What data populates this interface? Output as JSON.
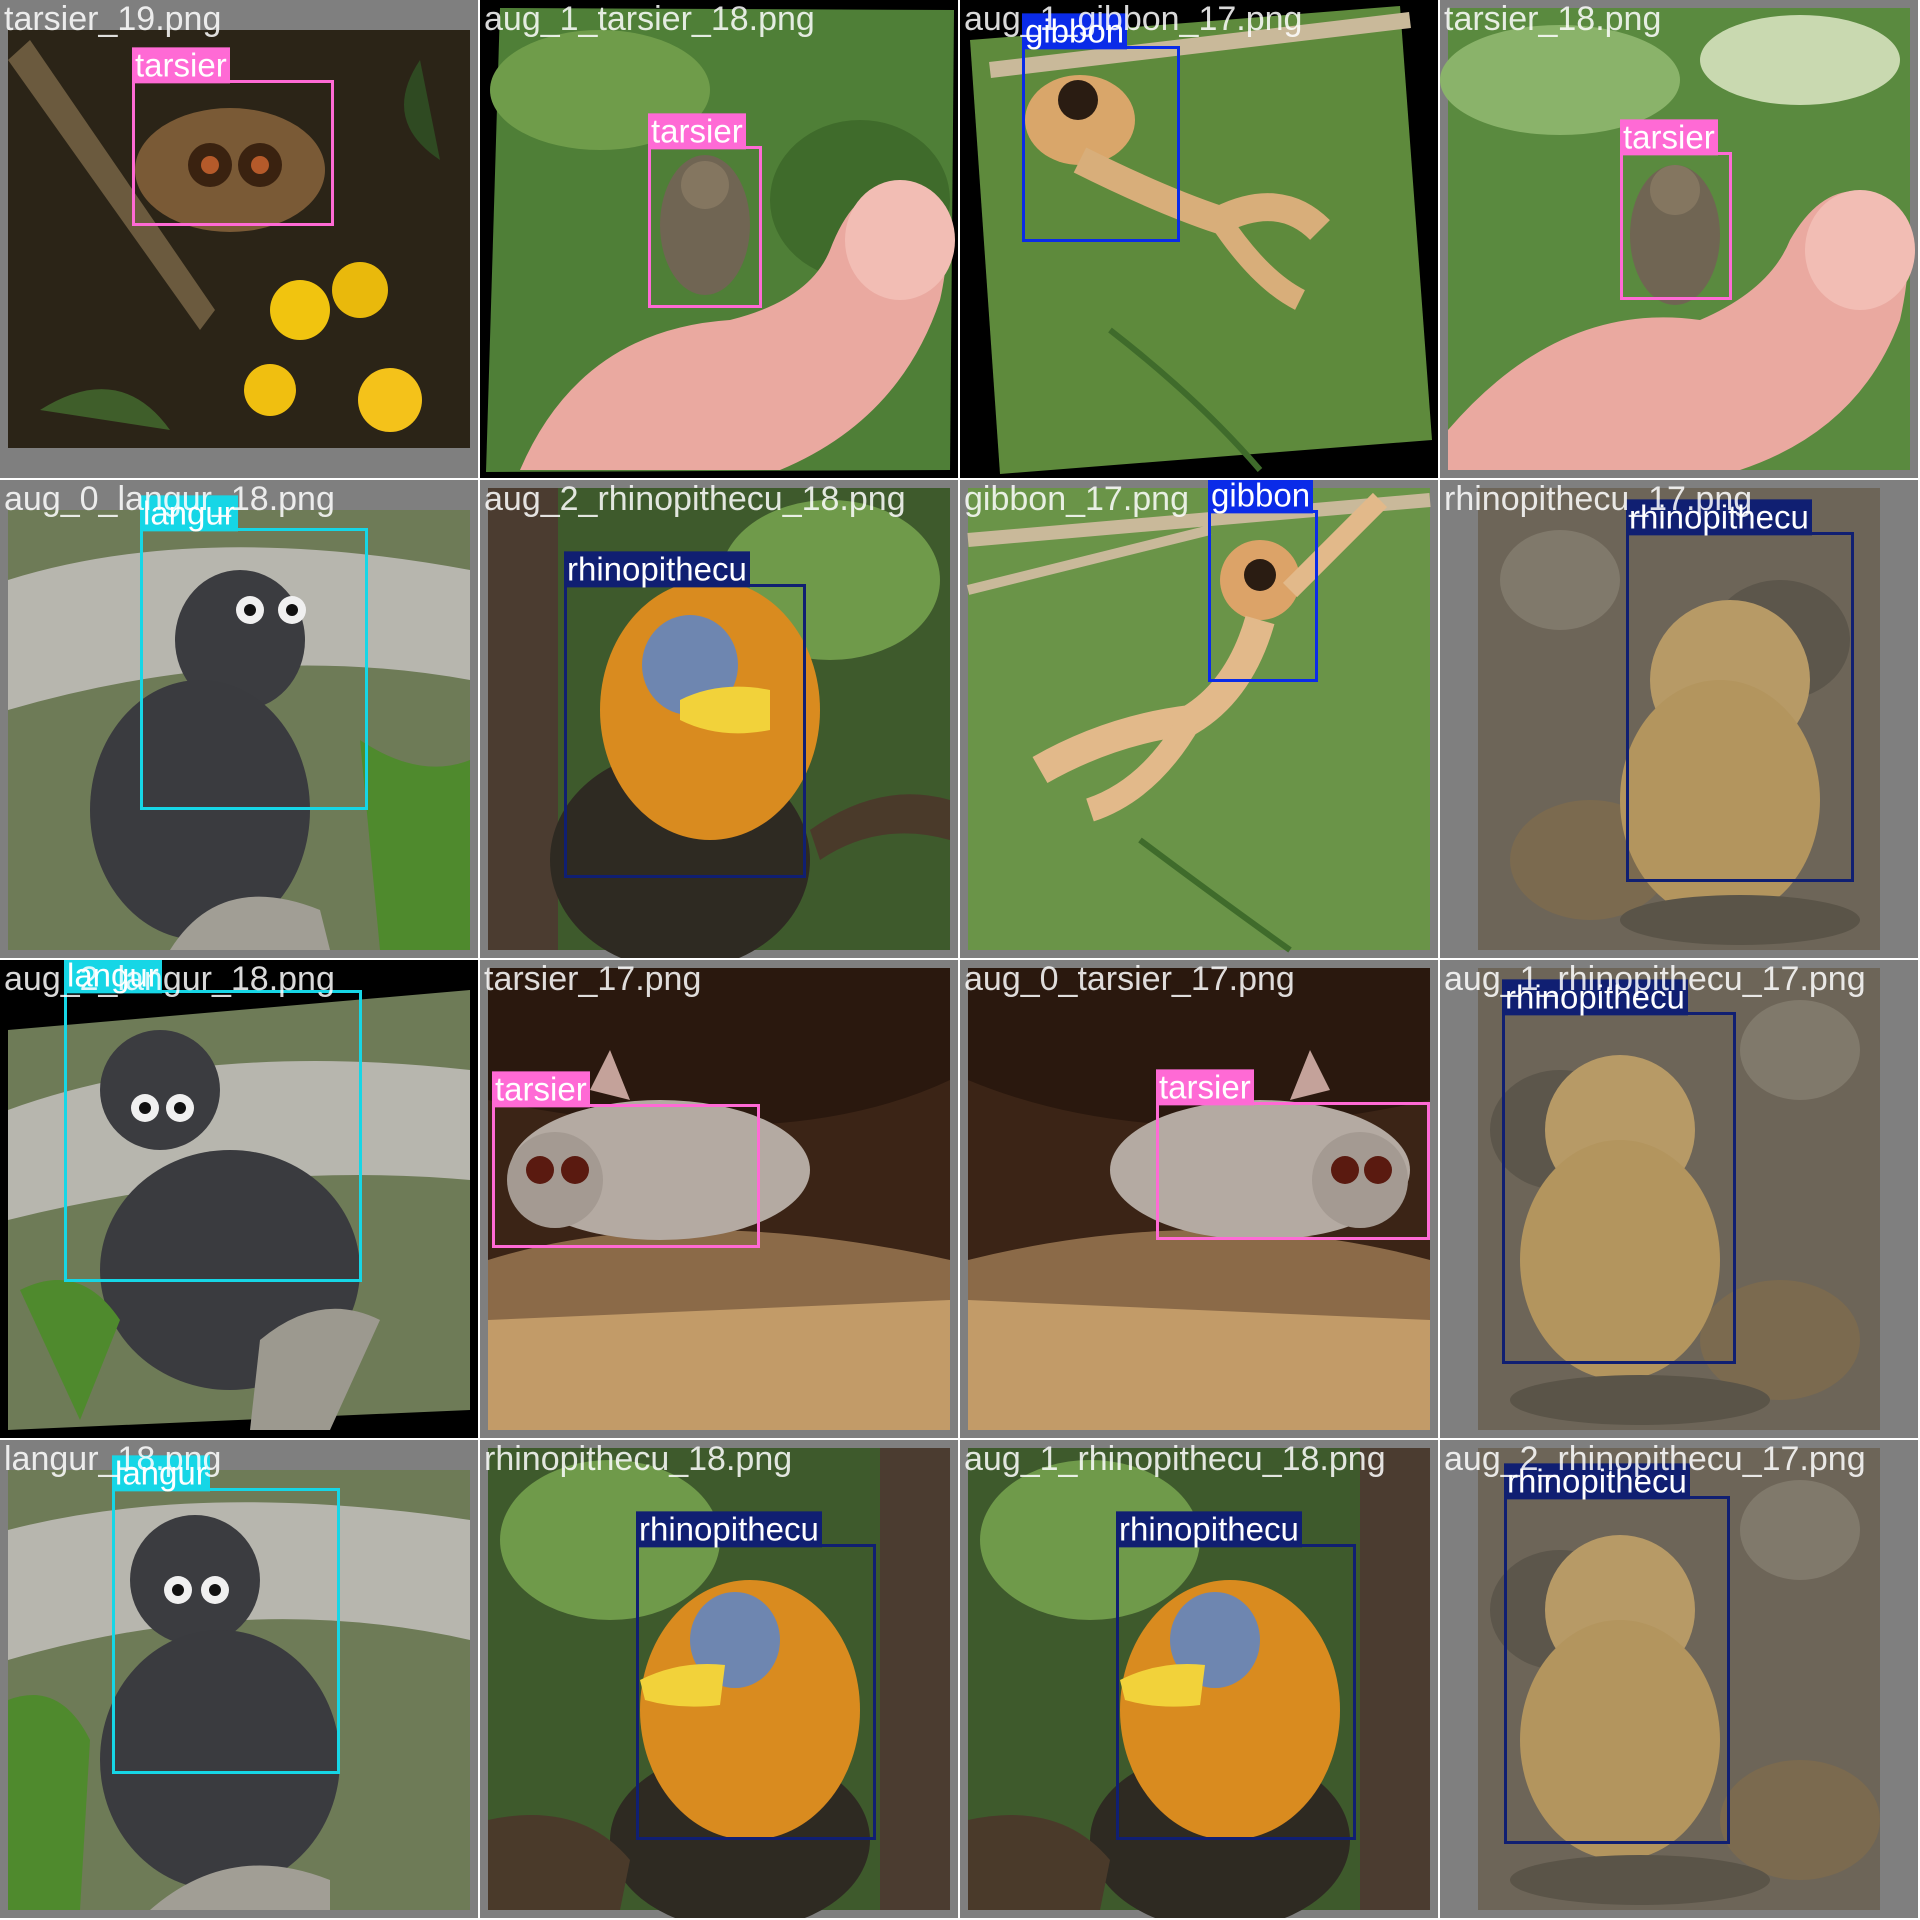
{
  "colors": {
    "tarsier": "#ff6ad5",
    "gibbon": "#0a2be8",
    "langur": "#16d6e6",
    "rhinopithecu": "#101f72"
  },
  "mosaic": {
    "tiles": [
      {
        "file": "tarsier_19.png",
        "scene": "tarsier-night-flowers",
        "detections": [
          {
            "label": "tarsier"
          }
        ]
      },
      {
        "file": "aug_1_tarsier_18.png",
        "scene": "tarsier-thumb-rotated",
        "detections": [
          {
            "label": "tarsier"
          }
        ]
      },
      {
        "file": "aug_1_gibbon_17.png",
        "scene": "gibbon-rope-rotated",
        "detections": [
          {
            "label": "gibbon"
          }
        ]
      },
      {
        "file": "tarsier_18.png",
        "scene": "tarsier-thumb",
        "detections": [
          {
            "label": "tarsier"
          }
        ]
      },
      {
        "file": "aug_0_langur_18.png",
        "scene": "langur-branch",
        "detections": [
          {
            "label": "langur"
          }
        ]
      },
      {
        "file": "aug_2_rhinopithecu_18.png",
        "scene": "golden-monkey-banana",
        "detections": [
          {
            "label": "rhinopithecu"
          }
        ]
      },
      {
        "file": "gibbon_17.png",
        "scene": "gibbon-rope",
        "detections": [
          {
            "label": "gibbon"
          }
        ]
      },
      {
        "file": "rhinopithecu_17.png",
        "scene": "young-golden-monkey",
        "detections": [
          {
            "label": "rhinopithecu"
          }
        ]
      },
      {
        "file": "aug_2_langur_18.png",
        "scene": "langur-branch-rotated",
        "detections": [
          {
            "label": "langur"
          }
        ]
      },
      {
        "file": "tarsier_17.png",
        "scene": "tarsier-lying",
        "detections": [
          {
            "label": "tarsier"
          }
        ]
      },
      {
        "file": "aug_0_tarsier_17.png",
        "scene": "tarsier-lying-flipped",
        "detections": [
          {
            "label": "tarsier"
          }
        ]
      },
      {
        "file": "aug_1_rhinopithecu_17.png",
        "scene": "young-golden-monkey-flipped",
        "detections": [
          {
            "label": "rhinopithecu"
          }
        ]
      },
      {
        "file": "langur_18.png",
        "scene": "langur-branch",
        "detections": [
          {
            "label": "langur"
          }
        ]
      },
      {
        "file": "rhinopithecu_18.png",
        "scene": "golden-monkey-banana",
        "detections": [
          {
            "label": "rhinopithecu"
          }
        ]
      },
      {
        "file": "aug_1_rhinopithecu_18.png",
        "scene": "golden-monkey-banana",
        "detections": [
          {
            "label": "rhinopithecu"
          }
        ]
      },
      {
        "file": "aug_2_rhinopithecu_17.png",
        "scene": "young-golden-monkey-flipped",
        "detections": [
          {
            "label": "rhinopithecu"
          }
        ]
      }
    ]
  }
}
